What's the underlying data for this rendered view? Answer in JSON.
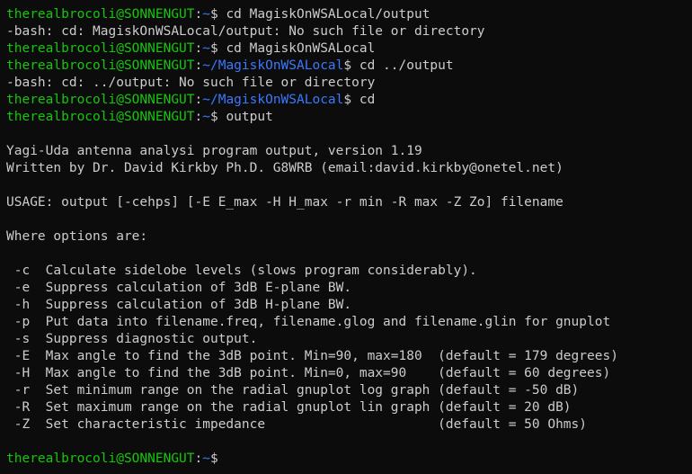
{
  "lines": [
    {
      "kind": "prompt",
      "user": "therealbrocoli@SONNENGUT",
      "path": "~",
      "cmd": " cd MagiskOnWSALocal/output"
    },
    {
      "kind": "text",
      "text": "-bash: cd: MagiskOnWSALocal/output: No such file or directory"
    },
    {
      "kind": "prompt",
      "user": "therealbrocoli@SONNENGUT",
      "path": "~",
      "cmd": " cd MagiskOnWSALocal"
    },
    {
      "kind": "prompt",
      "user": "therealbrocoli@SONNENGUT",
      "path": "~/MagiskOnWSALocal",
      "cmd": " cd ../output"
    },
    {
      "kind": "text",
      "text": "-bash: cd: ../output: No such file or directory"
    },
    {
      "kind": "prompt",
      "user": "therealbrocoli@SONNENGUT",
      "path": "~/MagiskOnWSALocal",
      "cmd": " cd"
    },
    {
      "kind": "prompt",
      "user": "therealbrocoli@SONNENGUT",
      "path": "~",
      "cmd": " output"
    },
    {
      "kind": "text",
      "text": ""
    },
    {
      "kind": "text",
      "text": "Yagi-Uda antenna analysi program output, version 1.19"
    },
    {
      "kind": "text",
      "text": "Written by Dr. David Kirkby Ph.D. G8WRB (email:david.kirkby@onetel.net)"
    },
    {
      "kind": "text",
      "text": ""
    },
    {
      "kind": "text",
      "text": "USAGE: output [-cehps] [-E E_max -H H_max -r min -R max -Z Zo] filename"
    },
    {
      "kind": "text",
      "text": ""
    },
    {
      "kind": "text",
      "text": "Where options are:"
    },
    {
      "kind": "text",
      "text": ""
    },
    {
      "kind": "text",
      "text": " -c  Calculate sidelobe levels (slows program considerably)."
    },
    {
      "kind": "text",
      "text": " -e  Suppress calculation of 3dB E-plane BW."
    },
    {
      "kind": "text",
      "text": " -h  Suppress calculation of 3dB H-plane BW."
    },
    {
      "kind": "text",
      "text": " -p  Put data into filename.freq, filename.glog and filename.glin for gnuplot"
    },
    {
      "kind": "text",
      "text": " -s  Suppress diagnostic output."
    },
    {
      "kind": "text",
      "text": " -E  Max angle to find the 3dB point. Min=90, max=180  (default = 179 degrees)"
    },
    {
      "kind": "text",
      "text": " -H  Max angle to find the 3dB point. Min=0, max=90    (default = 60 degrees)"
    },
    {
      "kind": "text",
      "text": " -r  Set minimum range on the radial gnuplot log graph (default = -50 dB)"
    },
    {
      "kind": "text",
      "text": " -R  Set maximum range on the radial gnuplot lin graph (default = 20 dB)"
    },
    {
      "kind": "text",
      "text": " -Z  Set characteristic impedance                      (default = 50 Ohms)"
    },
    {
      "kind": "text",
      "text": ""
    },
    {
      "kind": "prompt",
      "user": "therealbrocoli@SONNENGUT",
      "path": "~",
      "cmd": ""
    }
  ],
  "colors": {
    "background": "#0c0c0c",
    "text": "#cccccc",
    "user_host": "#16c60c",
    "path": "#3b78ff"
  }
}
